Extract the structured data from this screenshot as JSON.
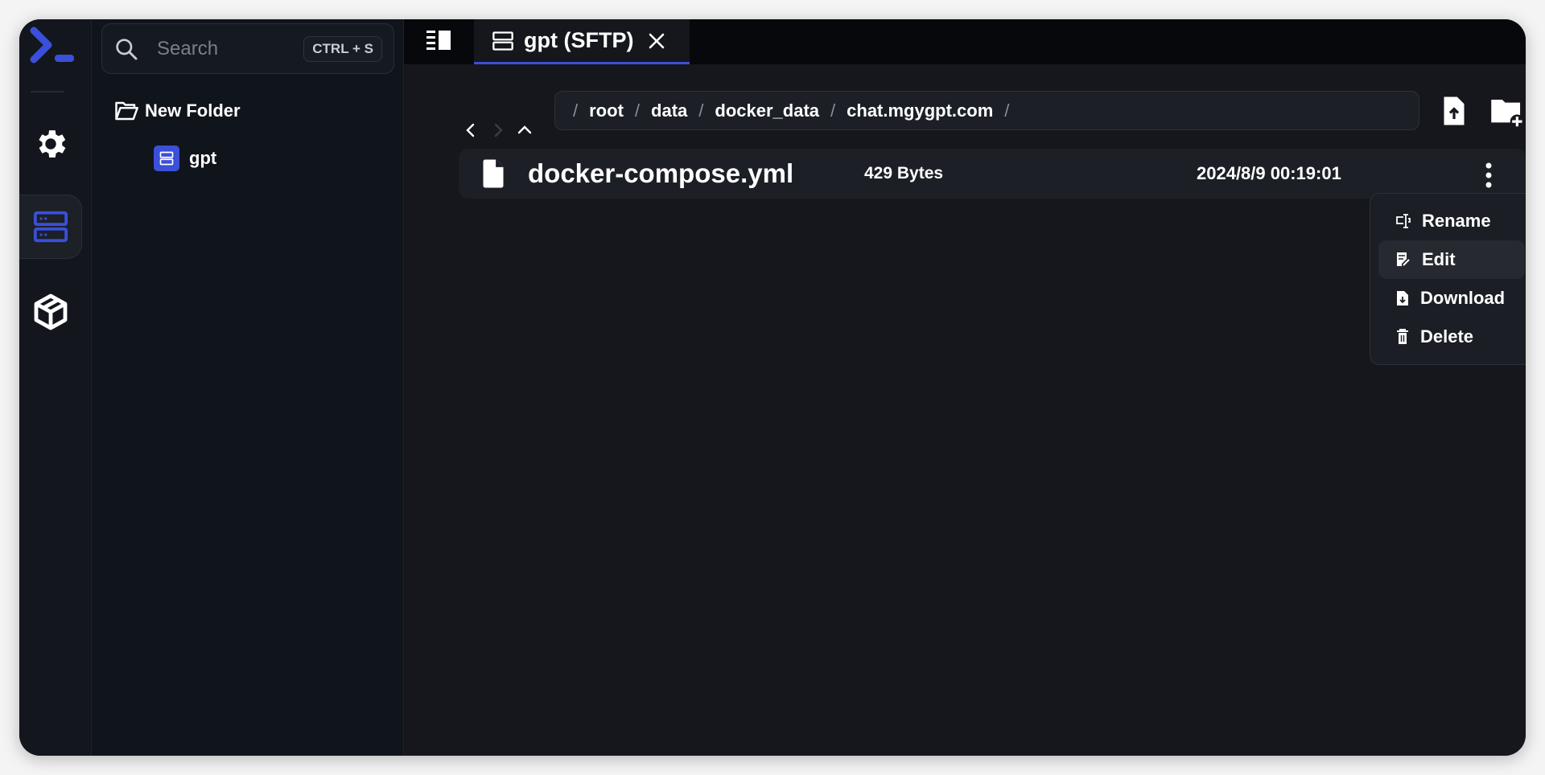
{
  "app": {
    "accent": "#3b4fd8"
  },
  "rail": {
    "items": [
      {
        "name": "settings",
        "icon": "gear-icon"
      },
      {
        "name": "hosts",
        "icon": "server-icon",
        "active": true
      },
      {
        "name": "packages",
        "icon": "package-icon"
      }
    ]
  },
  "sidebar": {
    "search": {
      "placeholder": "Search",
      "shortcut": "CTRL + S"
    },
    "tree": [
      {
        "label": "New Folder",
        "icon": "folder-open-icon"
      },
      {
        "label": "gpt",
        "icon": "server-icon"
      }
    ]
  },
  "tabs": [
    {
      "label": "gpt (SFTP)",
      "active": true
    }
  ],
  "browser": {
    "path": [
      "root",
      "data",
      "docker_data",
      "chat.mgygpt.com"
    ],
    "separator": "/",
    "files": [
      {
        "name": "docker-compose.yml",
        "size": "429 Bytes",
        "modified": "2024/8/9 00:19:01"
      }
    ],
    "context_menu": [
      {
        "label": "Rename",
        "icon": "rename-icon"
      },
      {
        "label": "Edit",
        "icon": "edit-icon",
        "highlighted": true
      },
      {
        "label": "Download",
        "icon": "download-file-icon"
      },
      {
        "label": "Delete",
        "icon": "trash-icon"
      }
    ]
  }
}
